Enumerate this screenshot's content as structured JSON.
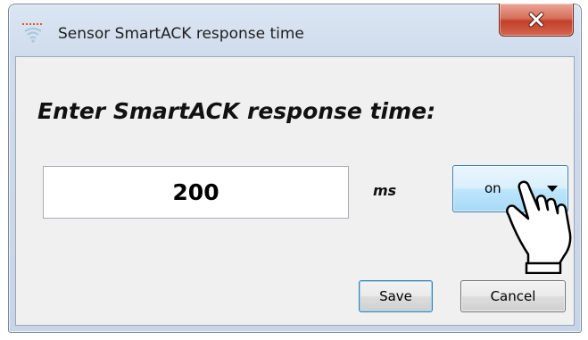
{
  "window": {
    "title": "Sensor SmartACK response time",
    "close_glyph": "✕"
  },
  "form": {
    "prompt": "Enter SmartACK response time:",
    "value": "200",
    "unit": "ms",
    "mode_selected": "on"
  },
  "buttons": {
    "save_label": "Save",
    "cancel_label": "Cancel"
  },
  "icons": {
    "app": "sensor-wave-icon",
    "close": "close-icon",
    "dropdown": "chevron-down-icon",
    "cursor": "hand-pointer-icon"
  },
  "colors": {
    "close_button": "#c7432d",
    "dropdown_highlight": "#bee6fd",
    "focus_border": "#3c7fb1"
  }
}
